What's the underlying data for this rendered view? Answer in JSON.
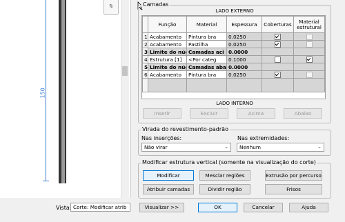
{
  "preview": {
    "dimension_text": "150",
    "mini_button": "⇅"
  },
  "layers": {
    "group_label": "Camadas",
    "outer_caption": "LADO EXTERNO",
    "inner_caption": "LADO INTERNO",
    "headers": [
      "",
      "Função",
      "Material",
      "Espessura",
      "Coberturas",
      "Material estrutural"
    ],
    "rows": [
      {
        "num": "1",
        "funcao": "Acabamento",
        "material": "Pintura bra",
        "espessura": "0.0250",
        "coberturas": true,
        "estrutural": false,
        "bold": false,
        "fill": "white"
      },
      {
        "num": "2",
        "funcao": "Acabamento",
        "material": "Pastilha",
        "espessura": "0.0250",
        "coberturas": true,
        "estrutural": false,
        "bold": false,
        "fill": "white"
      },
      {
        "num": "3",
        "funcao": "Limite do núc",
        "material": "Camadas aci",
        "espessura": "0.0000",
        "coberturas": null,
        "estrutural": null,
        "bold": true,
        "fill": "gray"
      },
      {
        "num": "4",
        "funcao": "Estrutura [1]",
        "material": "<Por categ",
        "espessura": "0.1000",
        "coberturas": false,
        "estrutural": true,
        "bold": false,
        "fill": "white"
      },
      {
        "num": "5",
        "funcao": "Limite do núc",
        "material": "Camadas abai",
        "espessura": "0.0000",
        "coberturas": null,
        "estrutural": null,
        "bold": true,
        "fill": "gray"
      },
      {
        "num": "6",
        "funcao": "Acabamento",
        "material": "Pintura bra",
        "espessura": "0.0250",
        "coberturas": true,
        "estrutural": false,
        "bold": false,
        "fill": "white"
      }
    ],
    "buttons": {
      "insert": "Inserir",
      "delete": "Excluir",
      "up": "Acima",
      "down": "Abaixo"
    }
  },
  "wrap": {
    "group_label": "Virada do revestimento-padrão",
    "inserts_label": "Nas inserções:",
    "inserts_value": "Não virar",
    "ends_label": "Nas extremidades:",
    "ends_value": "Nenhum"
  },
  "modify": {
    "group_label": "Modificar estrutura vertical (somente na visualização do corte)",
    "modify": "Modificar",
    "merge": "Mesclar regiões",
    "sweeps": "Extrusão por percurso",
    "assign": "Atribuir camadas",
    "split": "Dividir região",
    "reveals": "Frisos"
  },
  "footer": {
    "view_label": "Vista:",
    "view_value": "Corte: Modificar atrib",
    "preview_btn": "Visualizar >>",
    "ok": "OK",
    "cancel": "Cancelar",
    "help": "Ajuda"
  }
}
